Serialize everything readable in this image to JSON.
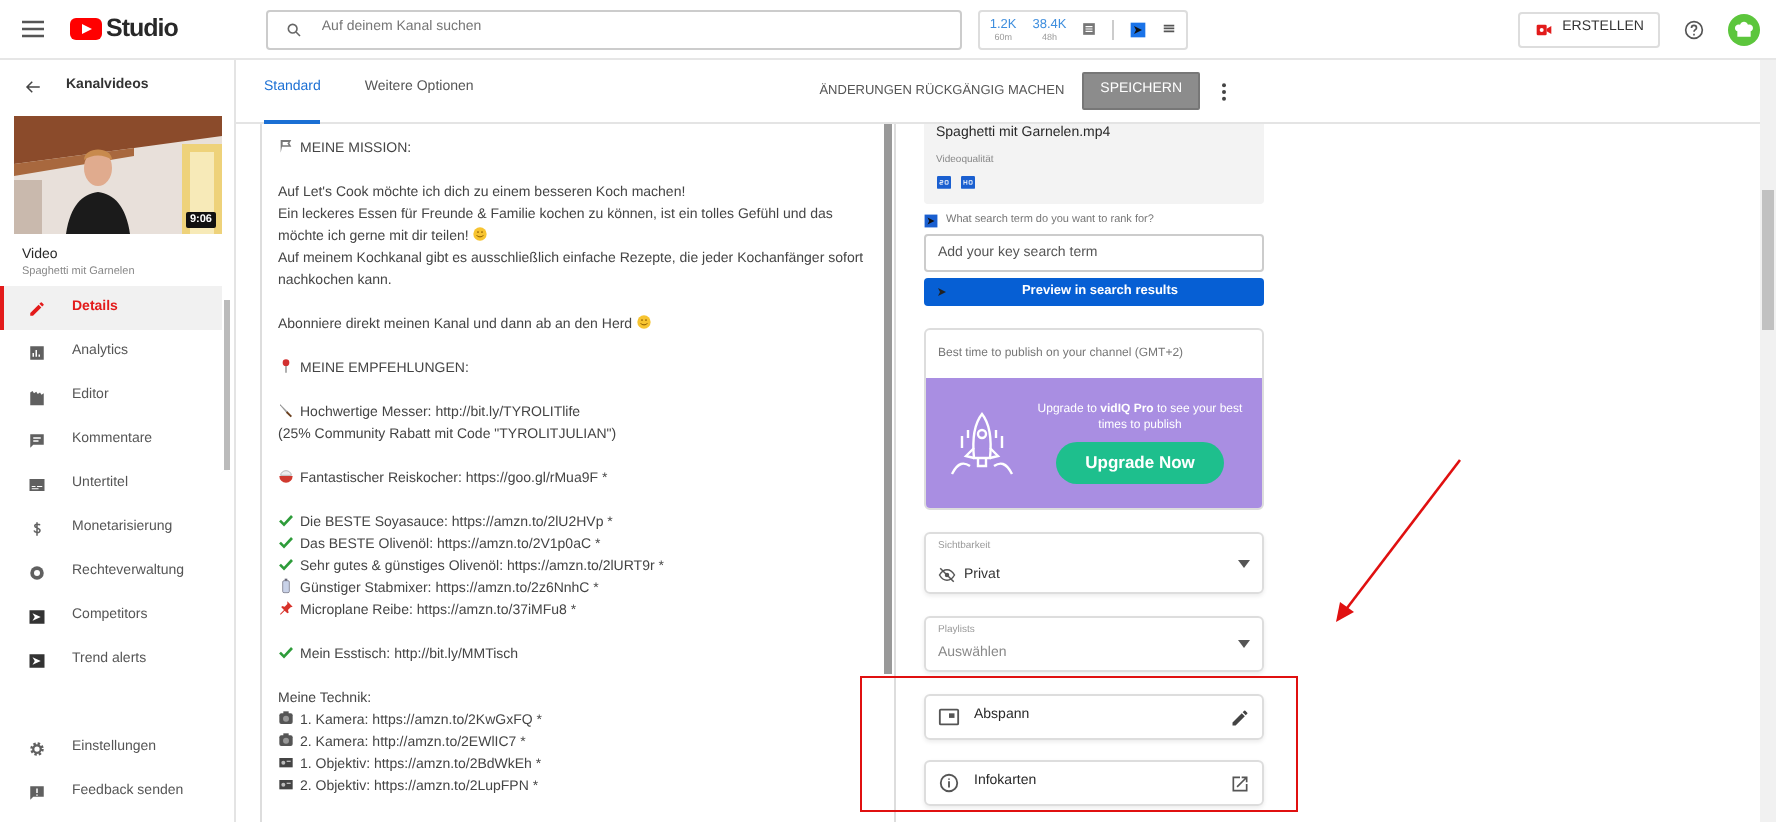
{
  "header": {
    "logo": "Studio",
    "search_placeholder": "Auf deinem Kanal suchen",
    "stats": [
      {
        "value": "1.2K",
        "period": "60m"
      },
      {
        "value": "38.4K",
        "period": "48h"
      }
    ],
    "create_button": "ERSTELLEN"
  },
  "sidebar": {
    "back_label": "Kanalvideos",
    "thumbnail": {
      "kind": "picture",
      "duration": "9:06"
    },
    "video_label": "Video",
    "video_title": "Spaghetti mit Garnelen",
    "items": [
      {
        "label": "Details",
        "selected": true
      },
      {
        "label": "Analytics",
        "selected": false
      },
      {
        "label": "Editor",
        "selected": false
      },
      {
        "label": "Kommentare",
        "selected": false
      },
      {
        "label": "Untertitel",
        "selected": false
      },
      {
        "label": "Monetarisierung",
        "selected": false
      },
      {
        "label": "Rechteverwaltung",
        "selected": false
      },
      {
        "label": "Competitors",
        "selected": false
      },
      {
        "label": "Trend alerts",
        "selected": false
      }
    ],
    "bottom_items": [
      {
        "label": "Einstellungen"
      },
      {
        "label": "Feedback senden"
      }
    ]
  },
  "tabs": [
    {
      "label": "Standard",
      "selected": true
    },
    {
      "label": "Weitere Optionen",
      "selected": false
    }
  ],
  "actions": {
    "undo": "ÄNDERUNGEN RÜCKGÄNGIG MACHEN",
    "save": "SPEICHERN"
  },
  "description": [
    [
      "MEINE MISSION:"
    ],
    [
      "Auf Let's Cook möchte ich dich zu einem besseren Koch machen!",
      "Ein leckeres Essen für Freunde & Familie kochen zu können, ist ein tolles Gefühl und das möchte ich gerne mit dir teilen!",
      "Auf meinem Kochkanal gibt es ausschließlich einfache Rezepte, die jeder Kochanfänger sofort nachkochen kann."
    ],
    [
      "Abonniere direkt meinen Kanal und dann ab an den Herd"
    ],
    [
      "MEINE EMPFEHLUNGEN:"
    ],
    [
      "Hochwertige Messer: http://bit.ly/TYROLITlife",
      "(25% Community Rabatt mit Code \"TYROLITJULIAN\")"
    ],
    [
      "Fantastischer Reiskocher: https://goo.gl/rMua9F *"
    ],
    [
      "Die BESTE Soyasauce: https://amzn.to/2lU2HVp *",
      "Das BESTE Olivenöl: https://amzn.to/2V1p0aC *",
      "Sehr gutes & günstiges Olivenöl: https://amzn.to/2lURT9r *",
      "Günstiger Stabmixer: https://amzn.to/2z6NnhC *",
      "Microplane Reibe: https://amzn.to/37iMFu8 *"
    ],
    [
      "Mein Esstisch: http://bit.ly/MMTisch"
    ],
    [
      "Meine Technik:",
      "1. Kamera: https://amzn.to/2KwGxFQ *",
      "2. Kamera: http://amzn.to/2EWlIC7 *",
      "1. Objektiv: https://amzn.to/2BdWkEh *",
      "2. Objektiv: https://amzn.to/2LupFPN *"
    ]
  ],
  "file_card": {
    "filename": "Spaghetti mit Garnelen.mp4",
    "quality_label": "Videoqualität"
  },
  "vidiq": {
    "keyword_prompt": "What search term do you want to rank for?",
    "keyword_placeholder": "Add your key search term",
    "preview_button": "Preview in search results",
    "best_time_title": "Best time to publish on your channel (GMT+2)",
    "upgrade_text": "Upgrade to **vidIQ Pro** to see your best times to publish",
    "upgrade_button": "Upgrade Now"
  },
  "visibility": {
    "label": "Sichtbarkeit",
    "value": "Privat"
  },
  "playlists": {
    "label": "Playlists",
    "placeholder": "Auswählen"
  },
  "features": [
    {
      "label": "Abspann"
    },
    {
      "label": "Infokarten"
    }
  ]
}
